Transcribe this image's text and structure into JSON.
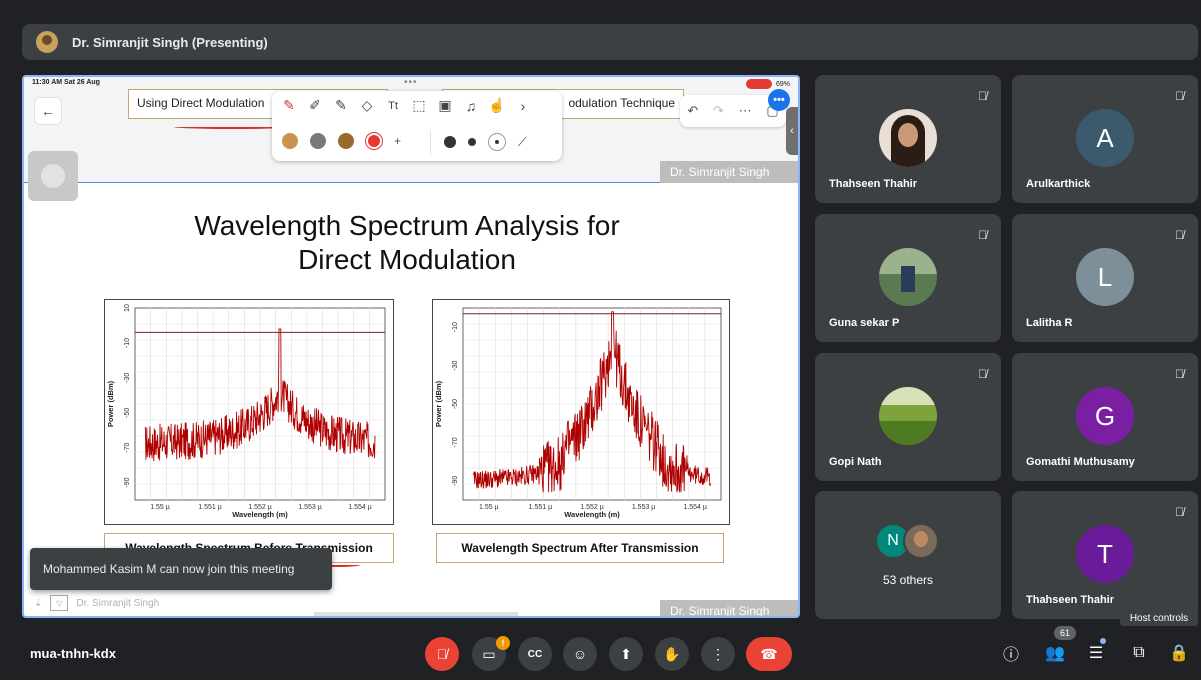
{
  "presenter": {
    "title": "Dr. Simranjit Singh (Presenting)"
  },
  "ipad": {
    "status_time": "11:30 AM  Sat 26 Aug",
    "battery": "69%",
    "tab_left": "Using Direct Modulation",
    "tab_right": "odulation Technique",
    "watermark": "Dr. Simranjit Singh"
  },
  "slide": {
    "title_line1": "Wavelength Spectrum Analysis for",
    "title_line2": "Direct Modulation",
    "caption_before": "Wavelength Spectrum Before Transmission",
    "caption_after": "Wavelength Spectrum After Transmission",
    "bottom_name": "Dr. Simranjit Singh"
  },
  "chart_data": [
    {
      "type": "line",
      "xlabel": "Wavelength (m)",
      "ylabel": "Power (dBm)",
      "x_ticks": [
        "1.55 µ",
        "1.551 µ",
        "1.552 µ",
        "1.553 µ",
        "1.554 µ"
      ],
      "y_ticks": [
        "10",
        "-10",
        "-30",
        "-50",
        "-70",
        "-90"
      ],
      "ylim": [
        -100,
        10
      ],
      "color": "#b00000",
      "peak_x": 1.5524,
      "peak_y": 0
    },
    {
      "type": "line",
      "xlabel": "Wavelength (m)",
      "ylabel": "Power (dBm)",
      "x_ticks": [
        "1.55 µ",
        "1.551 µ",
        "1.552 µ",
        "1.553 µ",
        "1.554 µ"
      ],
      "y_ticks": [
        "-10",
        "-30",
        "-50",
        "-70",
        "-90"
      ],
      "ylim": [
        -100,
        0
      ],
      "color": "#b00000",
      "peak_x": 1.5524,
      "peak_y": 0
    }
  ],
  "toast": {
    "message": "Mohammed Kasim M can now join this meeting"
  },
  "participants": [
    {
      "name": "Thahseen Thahir",
      "initial": "",
      "color": ""
    },
    {
      "name": "Arulkarthick",
      "initial": "A",
      "color": "#3c5a6e"
    },
    {
      "name": "Guna sekar P",
      "initial": "",
      "color": ""
    },
    {
      "name": "Lalitha R",
      "initial": "L",
      "color": "#7d8f99"
    },
    {
      "name": "Gopi Nath",
      "initial": "",
      "color": ""
    },
    {
      "name": "Gomathi Muthusamy",
      "initial": "G",
      "color": "#7b1fa2"
    },
    {
      "name": "Thahseen Thahir",
      "initial": "T",
      "color": "#6a1b9a"
    }
  ],
  "others": {
    "initial": "N",
    "label": "53 others"
  },
  "host_tooltip": "Host controls",
  "meeting_code": "mua-tnhn-kdx",
  "people_count": "61",
  "cam_alert": "!"
}
